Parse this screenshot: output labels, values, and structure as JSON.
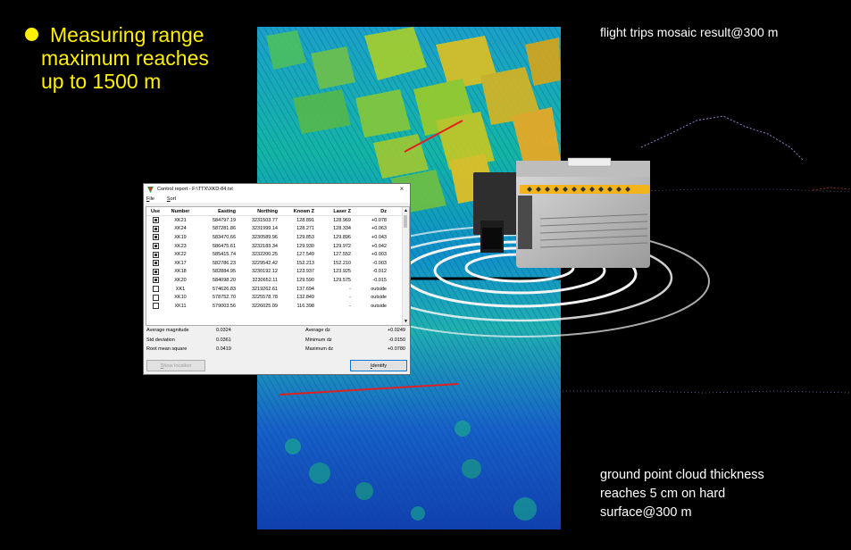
{
  "callout": {
    "lines": [
      "Measuring range",
      "maximum reaches",
      "up to 1500 m"
    ]
  },
  "caption_top": "flight trips mosaic result@300 m",
  "caption_bottom": [
    "ground point cloud thickness",
    "reaches 5 cm on hard",
    "surface@300 m"
  ],
  "colors": {
    "accent_yellow": "#ffef00",
    "background": "#000000"
  },
  "dialog": {
    "title": "Control report - F:\\TTX\\XKD-84.txt",
    "close_icon": "×",
    "menu": [
      {
        "key": "F",
        "rest": "ile"
      },
      {
        "key": "S",
        "rest": "ort"
      }
    ],
    "columns": [
      "Use",
      "Number",
      "Easting",
      "Northing",
      "Known Z",
      "Laser Z",
      "Dz"
    ],
    "rows": [
      {
        "use": true,
        "number": "XK21",
        "easting": "584797.19",
        "northing": "3231503.77",
        "known_z": "128.891",
        "laser_z": "128.969",
        "dz": "+0.078"
      },
      {
        "use": true,
        "number": "XK24",
        "easting": "587281.86",
        "northing": "3231999.14",
        "known_z": "128.271",
        "laser_z": "128.334",
        "dz": "+0.063"
      },
      {
        "use": true,
        "number": "XK19",
        "easting": "583470.66",
        "northing": "3230589.96",
        "known_z": "129.853",
        "laser_z": "129.896",
        "dz": "+0.043"
      },
      {
        "use": true,
        "number": "XK23",
        "easting": "586475.61",
        "northing": "3232183.34",
        "known_z": "129.930",
        "laser_z": "129.972",
        "dz": "+0.042"
      },
      {
        "use": true,
        "number": "XK22",
        "easting": "585415.74",
        "northing": "3232200.25",
        "known_z": "127.549",
        "laser_z": "127.552",
        "dz": "+0.003"
      },
      {
        "use": true,
        "number": "XK17",
        "easting": "582786.23",
        "northing": "3229542.42",
        "known_z": "152.213",
        "laser_z": "152.210",
        "dz": "-0.003"
      },
      {
        "use": true,
        "number": "XK18",
        "easting": "582884.95",
        "northing": "3230192.12",
        "known_z": "123.937",
        "laser_z": "123.925",
        "dz": "-0.012"
      },
      {
        "use": true,
        "number": "XK20",
        "easting": "584098.20",
        "northing": "3230652.11",
        "known_z": "129.590",
        "laser_z": "129.575",
        "dz": "-0.015"
      },
      {
        "use": false,
        "number": "XK1",
        "easting": "574626.83",
        "northing": "3219262.61",
        "known_z": "137.694",
        "laser_z": "-",
        "dz": "outside"
      },
      {
        "use": false,
        "number": "XK10",
        "easting": "578752.70",
        "northing": "3225578.78",
        "known_z": "132.849",
        "laser_z": "-",
        "dz": "outside"
      },
      {
        "use": false,
        "number": "XK11",
        "easting": "579003.56",
        "northing": "3226025.09",
        "known_z": "116.398",
        "laser_z": "-",
        "dz": "outside"
      }
    ],
    "stats": [
      {
        "label": "Average magnitude",
        "value": "0.0324",
        "label2": "Average dz",
        "value2": "+0.0249"
      },
      {
        "label": "Std deviation",
        "value": "0.0361",
        "label2": "Minimum dz",
        "value2": "-0.0150"
      },
      {
        "label": "Root mean square",
        "value": "0.0419",
        "label2": "Maximum dz",
        "value2": "+0.0780"
      }
    ],
    "show_location": {
      "key": "S",
      "rest": "how location"
    },
    "identify": {
      "key": "I",
      "rest": "dentify"
    }
  }
}
